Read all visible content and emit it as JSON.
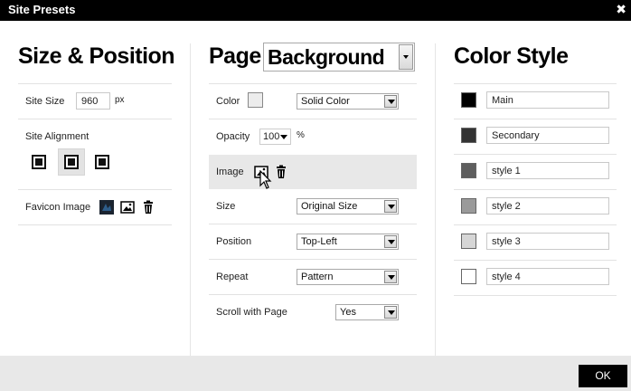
{
  "window": {
    "title": "Site Presets",
    "close_glyph": "✖"
  },
  "size_position": {
    "heading": "Size & Position",
    "site_size_label": "Site Size",
    "site_size_value": "960",
    "site_size_unit": "px",
    "site_alignment_label": "Site Alignment",
    "alignment_selected": "center",
    "favicon_label": "Favicon Image"
  },
  "page_background": {
    "heading_prefix": "Page",
    "heading_select_value": "Background",
    "color_label": "Color",
    "color_value_swatch": "#ececec",
    "color_type_value": "Solid Color",
    "opacity_label": "Opacity",
    "opacity_value": "100",
    "opacity_unit": "%",
    "image_label": "Image",
    "size_label": "Size",
    "size_value": "Original Size",
    "position_label": "Position",
    "position_value": "Top-Left",
    "repeat_label": "Repeat",
    "repeat_value": "Pattern",
    "scroll_label": "Scroll with Page",
    "scroll_value": "Yes"
  },
  "color_style": {
    "heading": "Color Style",
    "items": [
      {
        "name": "Main",
        "color": "#000000"
      },
      {
        "name": "Secondary",
        "color": "#333333"
      },
      {
        "name": "style 1",
        "color": "#5e5e5e"
      },
      {
        "name": "style 2",
        "color": "#9a9a9a"
      },
      {
        "name": "style 3",
        "color": "#d6d6d6"
      },
      {
        "name": "style 4",
        "color": "#ffffff"
      }
    ]
  },
  "footer": {
    "ok_label": "OK"
  }
}
